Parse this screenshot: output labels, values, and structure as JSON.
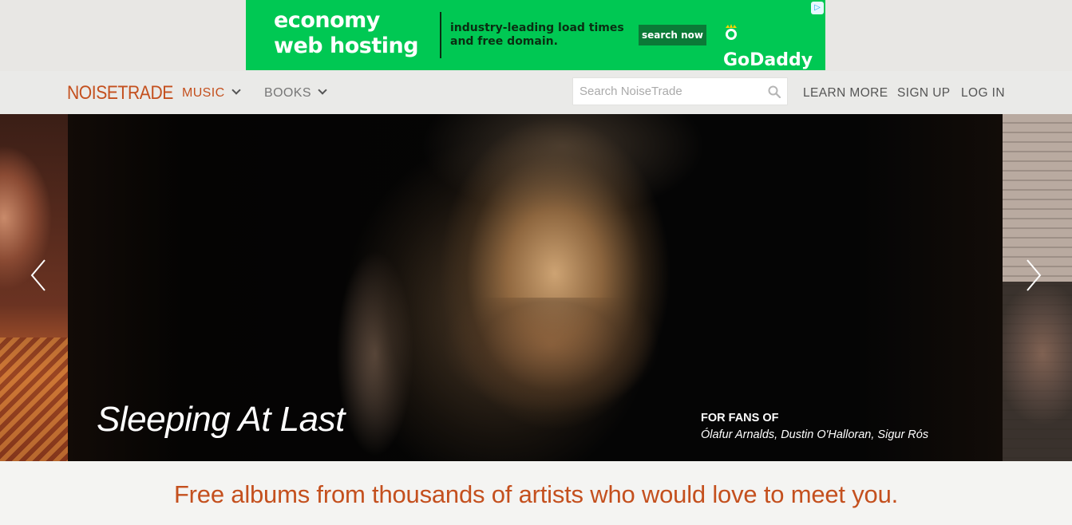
{
  "ad": {
    "headline_line1": "economy",
    "headline_line2": "web hosting",
    "tagline": "industry-leading load times and free domain.",
    "cta": "search now",
    "brand": "GoDaddy",
    "choices_icon": "ad-choices-icon",
    "bg_color": "#00c853"
  },
  "nav": {
    "logo": "NOISETRADE",
    "music": "MUSIC",
    "books": "BOOKS",
    "search_placeholder": "Search NoiseTrade",
    "learn_more": "LEARN MORE",
    "sign_up": "SIGN UP",
    "log_in": "LOG IN",
    "accent_color": "#c4501e"
  },
  "hero": {
    "artist": "Sleeping At Last",
    "for_fans_label": "FOR FANS OF",
    "for_fans_list": "Ólafur Arnalds, Dustin O'Halloran, Sigur Rós",
    "prev_icon": "chevron-left-icon",
    "next_icon": "chevron-right-icon"
  },
  "tagline": "Free albums from thousands of artists who would love to meet you."
}
